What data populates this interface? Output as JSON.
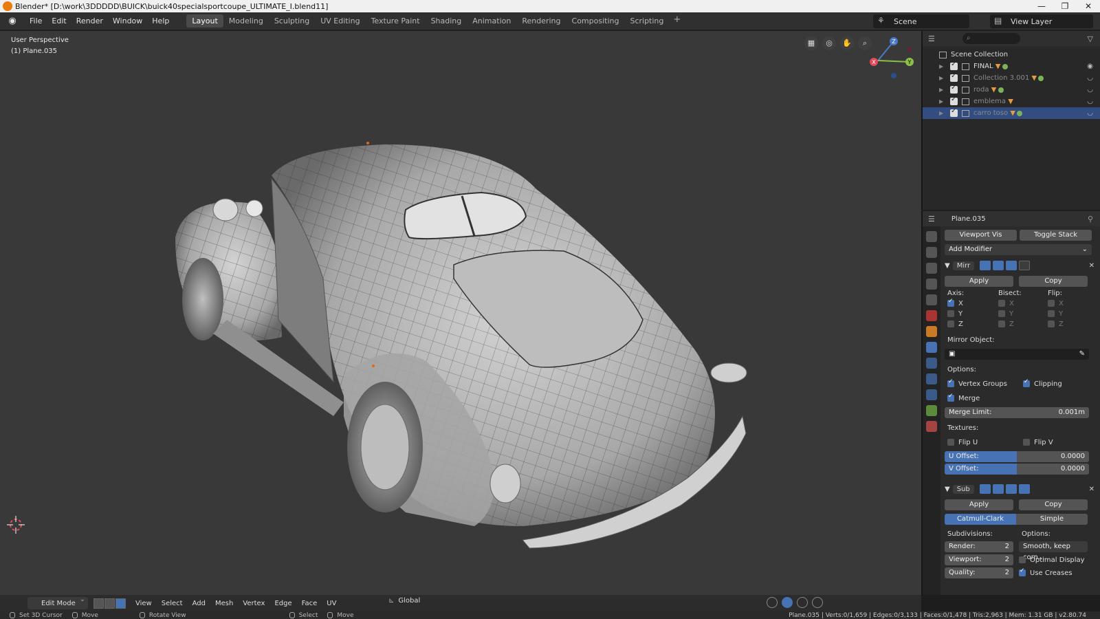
{
  "window": {
    "title": "Blender* [D:\\work\\3DDDDD\\BUICK\\buick40specialsportcoupe_ULTIMATE_I.blend11]",
    "controls": [
      "—",
      "❐",
      "✕"
    ]
  },
  "menu": [
    "File",
    "Edit",
    "Render",
    "Window",
    "Help"
  ],
  "workspaces": [
    "Layout",
    "Modeling",
    "Sculpting",
    "UV Editing",
    "Texture Paint",
    "Shading",
    "Animation",
    "Rendering",
    "Compositing",
    "Scripting"
  ],
  "active_workspace": "Layout",
  "scene": "Scene",
  "view_layer": "View Layer",
  "viewport": {
    "perspective": "User Perspective",
    "object": "(1) Plane.035",
    "gizmo_axes": [
      "Z",
      "Y",
      "X"
    ]
  },
  "viewport_header": {
    "mode": "Edit Mode",
    "menus": [
      "View",
      "Select",
      "Add",
      "Mesh",
      "Vertex",
      "Edge",
      "Face",
      "UV"
    ],
    "orientation": "Global"
  },
  "outliner": {
    "root": "Scene Collection",
    "collections": [
      {
        "name": "FINAL",
        "dim": false,
        "selected": false
      },
      {
        "name": "Collection 3.001",
        "dim": true,
        "selected": false
      },
      {
        "name": "roda",
        "dim": true,
        "selected": false
      },
      {
        "name": "emblema",
        "dim": true,
        "selected": false
      },
      {
        "name": "carro toso",
        "dim": true,
        "selected": true
      }
    ]
  },
  "properties": {
    "object_name": "Plane.035",
    "viewport_vis": "Viewport Vis",
    "toggle_stack": "Toggle Stack",
    "add_modifier": "Add Modifier",
    "mirror": {
      "name": "Mirr",
      "apply": "Apply",
      "copy": "Copy",
      "axis_label": "Axis:",
      "bisect_label": "Bisect:",
      "flip_label": "Flip:",
      "axes": [
        "X",
        "Y",
        "Z"
      ],
      "mirror_object_label": "Mirror Object:",
      "options_label": "Options:",
      "vertex_groups": "Vertex Groups",
      "clipping": "Clipping",
      "merge": "Merge",
      "merge_limit_label": "Merge Limit:",
      "merge_limit_value": "0.001m",
      "textures_label": "Textures:",
      "flip_u": "Flip U",
      "flip_v": "Flip V",
      "u_offset_label": "U Offset:",
      "u_offset_value": "0.0000",
      "v_offset_label": "V Offset:",
      "v_offset_value": "0.0000"
    },
    "subsurf": {
      "name": "Sub",
      "apply": "Apply",
      "copy": "Copy",
      "catmull": "Catmull-Clark",
      "simple": "Simple",
      "subdivisions_label": "Subdivisions:",
      "options_label": "Options:",
      "render_label": "Render:",
      "render_value": "2",
      "viewport_label": "Viewport:",
      "viewport_value": "2",
      "quality_label": "Quality:",
      "quality_value": "2",
      "uv_smooth": "Smooth, keep corn...",
      "optimal_display": "Optimal Display",
      "use_creases": "Use Creases"
    }
  },
  "statusbar": {
    "items": [
      "Set 3D Cursor",
      "Move",
      "Rotate View",
      "Select",
      "Move"
    ],
    "stats": "Plane.035 | Verts:0/1,659 | Edges:0/3,133 | Faces:0/1,478 | Tris:2,963 | Mem: 1.31 GB | v2.80.74"
  },
  "colors": {
    "accent": "#4772b3",
    "selection": "#334d80",
    "viewport_bg": "#393939"
  }
}
